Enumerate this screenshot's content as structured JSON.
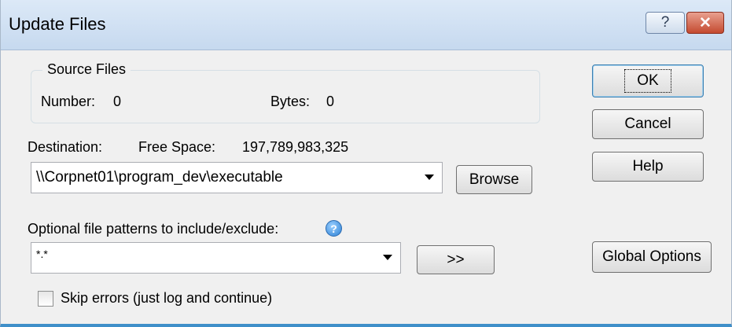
{
  "window": {
    "title": "Update Files"
  },
  "titlebar": {
    "help_glyph": "?",
    "close_glyph": "✕"
  },
  "source_files": {
    "legend": "Source Files",
    "number_label": "Number:",
    "number_value": "0",
    "bytes_label": "Bytes:",
    "bytes_value": "0"
  },
  "destination": {
    "label": "Destination:",
    "free_space_label": "Free Space:",
    "free_space_value": "197,789,983,325",
    "path_value": "\\\\Corpnet01\\program_dev\\executable",
    "browse_label": "Browse"
  },
  "patterns": {
    "label": "Optional file patterns to include/exclude:",
    "info_glyph": "?",
    "value": "*.*",
    "more_label": ">>"
  },
  "skip_errors": {
    "label": "Skip errors (just log and continue)",
    "checked": false
  },
  "buttons": {
    "ok": "OK",
    "cancel": "Cancel",
    "help": "Help",
    "global_options": "Global Options"
  }
}
